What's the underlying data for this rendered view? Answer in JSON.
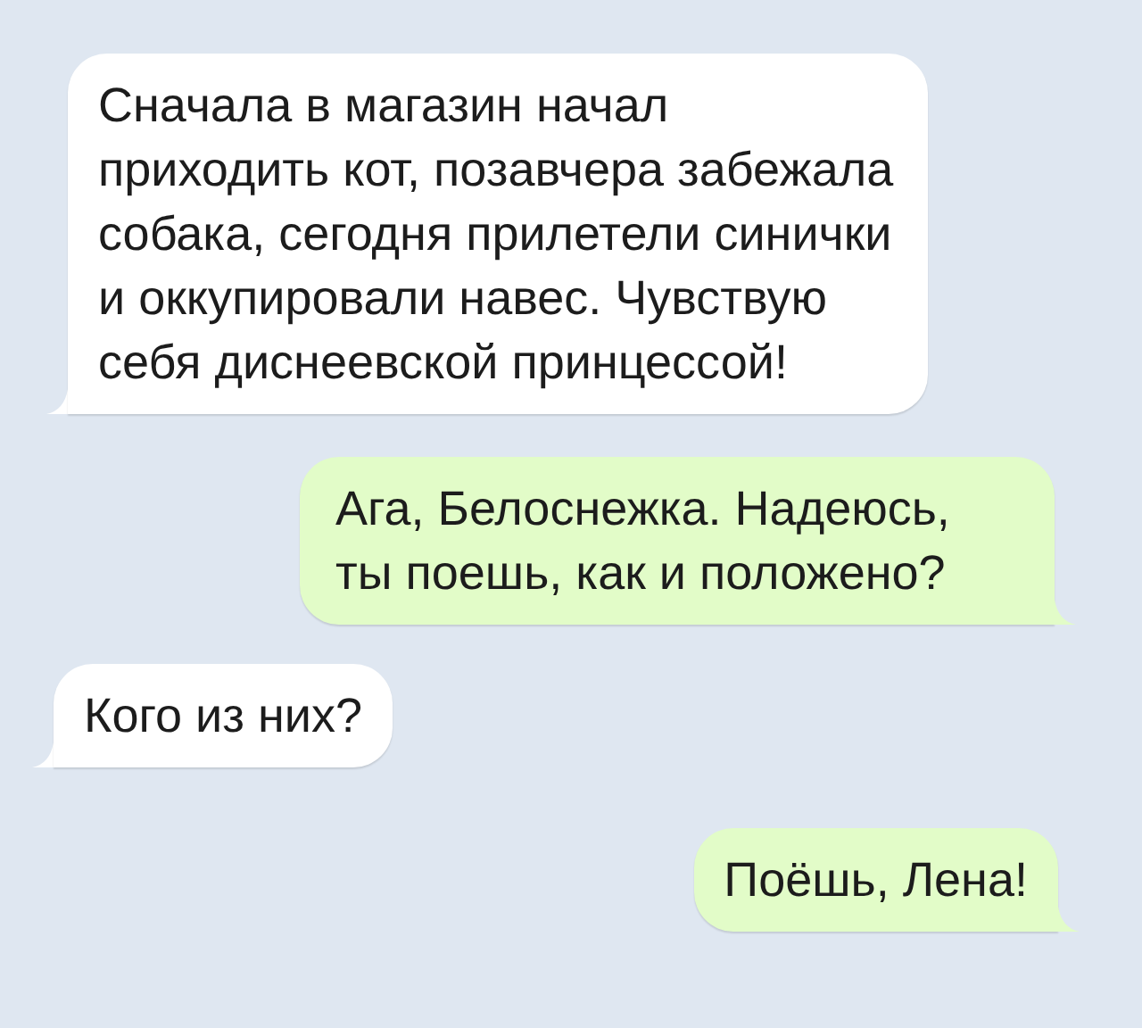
{
  "messages": [
    {
      "kind": "incoming",
      "text": "Сначала в магазин начал приходить кот, позавчера забежала собака, сегодня прилетели синички и оккупировали навес. Чувствую себя диснеевской принцессой!"
    },
    {
      "kind": "outgoing",
      "text": "Ага, Белоснежка. Надеюсь, ты поешь, как и положено?"
    },
    {
      "kind": "incoming",
      "text": "Кого из них?"
    },
    {
      "kind": "outgoing",
      "text": "Поёшь, Лена!"
    }
  ]
}
